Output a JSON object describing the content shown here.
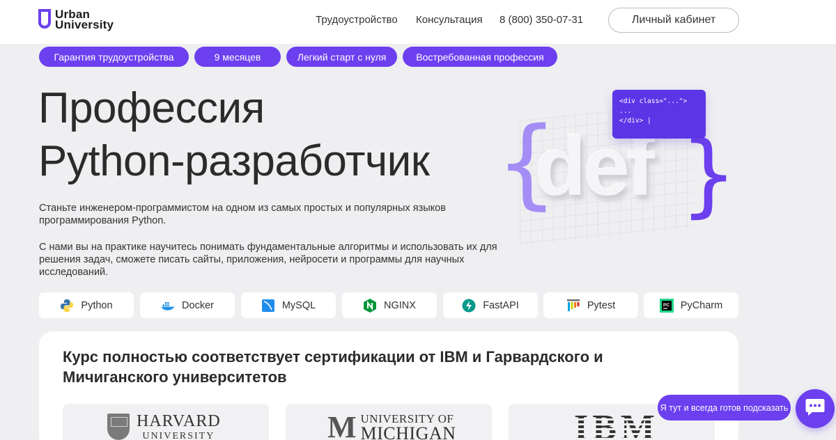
{
  "header": {
    "logo_line1": "Urban",
    "logo_line2": "University",
    "nav": [
      {
        "label": "Трудоустройство"
      },
      {
        "label": "Консультация"
      },
      {
        "label": "8 (800) 350-07-31"
      }
    ],
    "cabinet_label": "Личный кабинет"
  },
  "pills": [
    {
      "label": "Гарантия трудоустройства"
    },
    {
      "label": "9 месяцев"
    },
    {
      "label": "Легкий старт с нуля"
    },
    {
      "label": "Востребованная профессия"
    }
  ],
  "hero": {
    "title_line1": "Профессия",
    "title_line2": "Python-разработчик",
    "desc1": "Станьте инженером-программистом на одном из самых простых и популярных языков программирования Python.",
    "desc2": "С нами вы на практике научитесь понимать фундаментальные алгоритмы и использовать их для решения задач, сможете писать сайты, приложения, нейросети и программы для научных исследований."
  },
  "illustration": {
    "brace_left": "{",
    "brace_right": "}",
    "word": "def",
    "code_line1": "<div class=\"...\">",
    "code_line2": "...",
    "code_line3": "</div>"
  },
  "tech": [
    {
      "label": "Python",
      "icon": "python-icon"
    },
    {
      "label": "Docker",
      "icon": "docker-icon"
    },
    {
      "label": "MySQL",
      "icon": "mysql-icon"
    },
    {
      "label": "NGINX",
      "icon": "nginx-icon"
    },
    {
      "label": "FastAPI",
      "icon": "fastapi-icon"
    },
    {
      "label": "Pytest",
      "icon": "pytest-icon"
    },
    {
      "label": "PyCharm",
      "icon": "pycharm-icon"
    }
  ],
  "cert": {
    "title": "Курс полностью соответствует сертификации от IBM и Гарвардского и Мичиганского университетов",
    "harvard_name": "HARVARD",
    "harvard_sub": "UNIVERSITY",
    "michigan_line1": "UNIVERSITY OF",
    "michigan_line2": "MICHIGAN",
    "michigan_mark": "M",
    "ibm": "IBM"
  },
  "chat": {
    "bubble": "Я тут и всегда готов подсказать"
  },
  "colors": {
    "accent": "#6c3fef",
    "background": "#efeff1"
  }
}
